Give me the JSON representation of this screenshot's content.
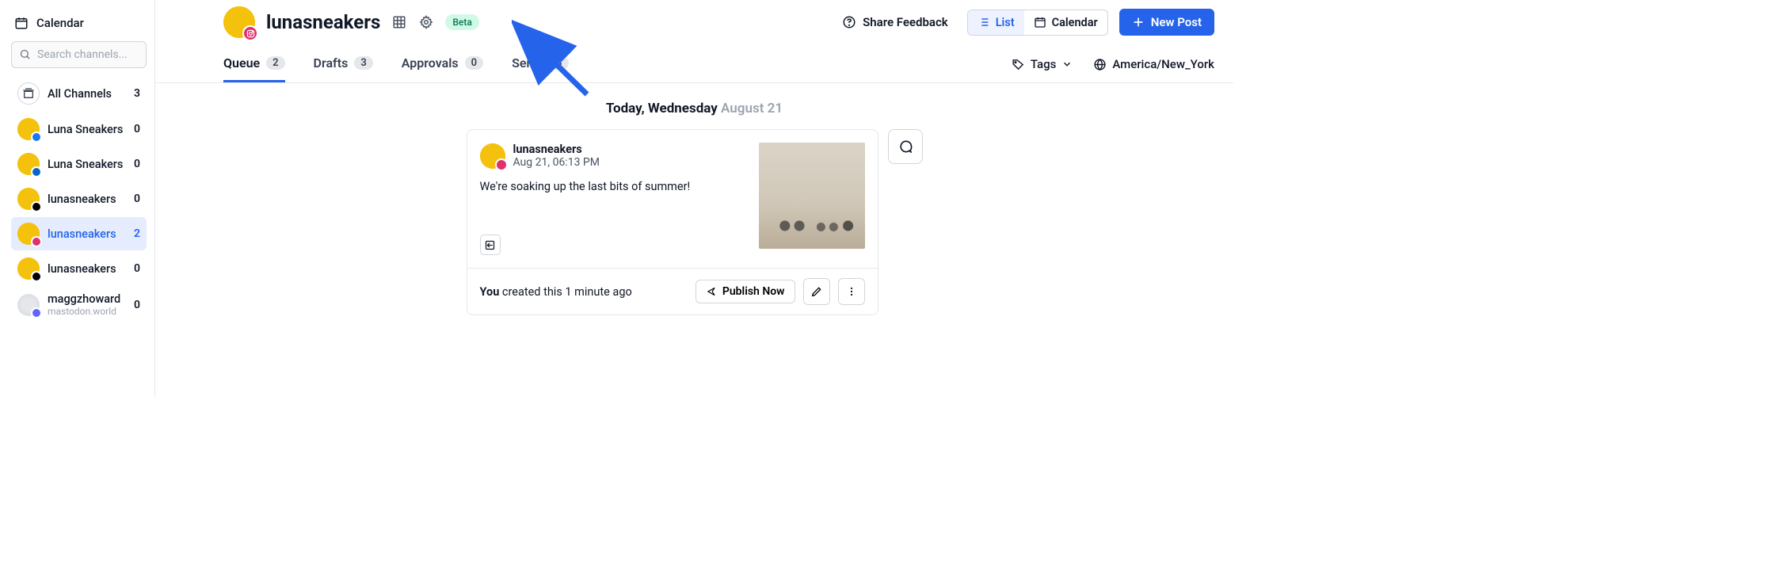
{
  "sidebar": {
    "calendar_label": "Calendar",
    "search_placeholder": "Search channels...",
    "all_channels_label": "All Channels",
    "all_channels_count": "3",
    "channels": [
      {
        "label": "Luna Sneakers",
        "count": "0",
        "network": "facebook"
      },
      {
        "label": "Luna Sneakers",
        "count": "0",
        "network": "linkedin"
      },
      {
        "label": "lunasneakers",
        "count": "0",
        "network": "threads"
      },
      {
        "label": "lunasneakers",
        "count": "2",
        "network": "instagram"
      },
      {
        "label": "lunasneakers",
        "count": "0",
        "network": "tiktok"
      },
      {
        "label": "maggzhoward",
        "sublabel": "mastodon.world",
        "count": "0",
        "network": "mastodon"
      }
    ]
  },
  "header": {
    "title": "lunasneakers",
    "beta_label": "Beta",
    "feedback_label": "Share Feedback",
    "list_label": "List",
    "calendar_label": "Calendar",
    "newpost_label": "New Post"
  },
  "tabs": {
    "items": [
      {
        "label": "Queue",
        "count": "2"
      },
      {
        "label": "Drafts",
        "count": "3"
      },
      {
        "label": "Approvals",
        "count": "0"
      },
      {
        "label": "Sent",
        "count": "63"
      }
    ],
    "tags_label": "Tags",
    "timezone_label": "America/New_York"
  },
  "day": {
    "prefix": "Today, Wednesday",
    "date": "August 21"
  },
  "post": {
    "name": "lunasneakers",
    "time": "Aug 21, 06:13 PM",
    "text": "We're soaking up the last bits of summer!",
    "you_label": "You",
    "created_suffix": " created this 1 minute ago",
    "publish_label": "Publish Now"
  }
}
